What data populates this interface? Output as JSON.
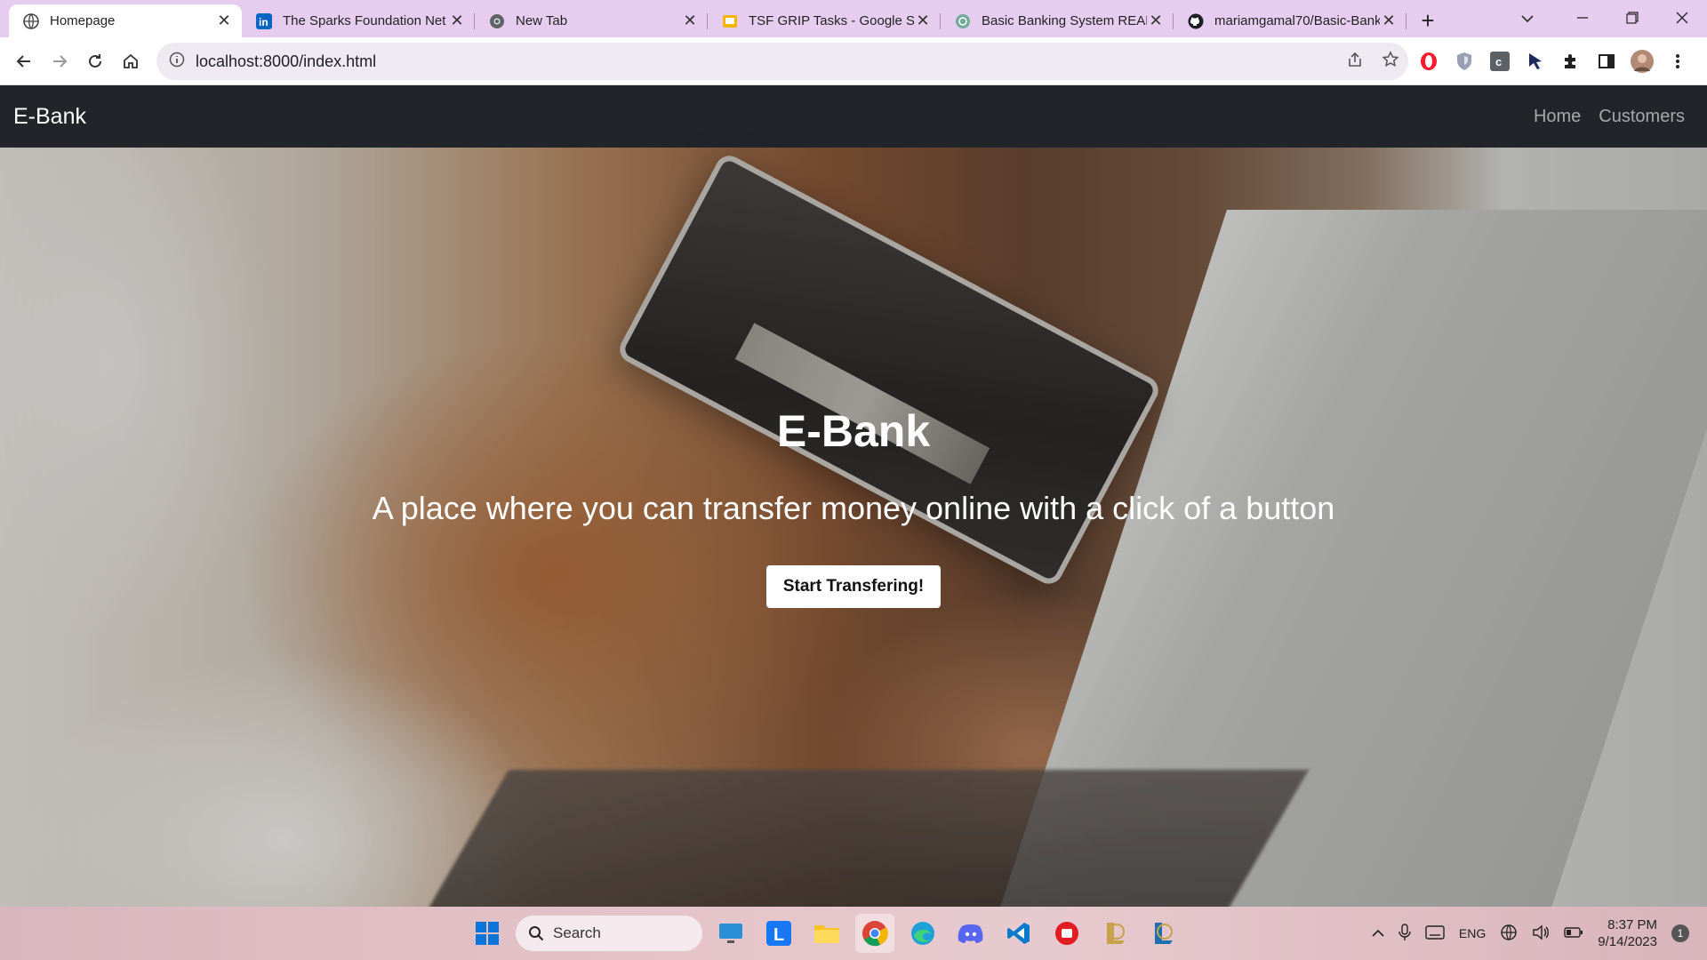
{
  "browser": {
    "tabs": [
      {
        "title": "Homepage",
        "icon": "globe-icon",
        "active": true
      },
      {
        "title": "The Sparks Foundation Net",
        "icon": "linkedin-icon",
        "active": false
      },
      {
        "title": "New Tab",
        "icon": "chrome-icon",
        "active": false
      },
      {
        "title": "TSF GRIP Tasks - Google Sli",
        "icon": "google-slides-icon",
        "active": false
      },
      {
        "title": "Basic Banking System READ",
        "icon": "openai-icon",
        "active": false
      },
      {
        "title": "mariamgamal70/Basic-Bank",
        "icon": "github-icon",
        "active": false
      }
    ],
    "new_tab_label": "+",
    "url": "localhost:8000/index.html"
  },
  "site": {
    "brand": "E-Bank",
    "nav": [
      {
        "label": "Home"
      },
      {
        "label": "Customers"
      }
    ],
    "hero": {
      "title": "E-Bank",
      "subtitle": "A place where you can transfer money online with a click of a button",
      "button": "Start Transfering!"
    }
  },
  "taskbar": {
    "search_placeholder": "Search",
    "language": "ENG",
    "time": "8:37 PM",
    "date": "9/14/2023",
    "notifications": "1"
  },
  "colors": {
    "tabstrip": "#e6cdef",
    "navbar": "#212529",
    "button": "#ffffff"
  }
}
